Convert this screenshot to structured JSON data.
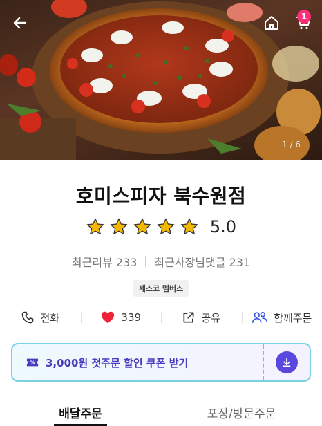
{
  "hero": {
    "pager": "1 / 6",
    "cart_count": "1",
    "icons": [
      "back-arrow-icon",
      "home-icon",
      "cart-icon"
    ]
  },
  "store": {
    "name": "호미스피자 북수원점",
    "rating": "5.0",
    "stars": 5,
    "recent_reviews": "최근리뷰 233",
    "owner_replies": "최근사장님댓글 231",
    "badge": "세스코 멤버스"
  },
  "actions": {
    "call": "전화",
    "likes": "339",
    "share": "공유",
    "group_order": "함께주문"
  },
  "coupon": {
    "text": "3,000원 첫주문 할인 쿠폰 받기"
  },
  "tabs": {
    "delivery": "배달주문",
    "pickup": "포장/방문주문"
  },
  "colors": {
    "star": "#f5b800",
    "heart": "#f0223a",
    "coupon_text": "#4a3bbf",
    "coupon_button": "#5a47e0",
    "cart_badge": "#ff2d7a"
  }
}
